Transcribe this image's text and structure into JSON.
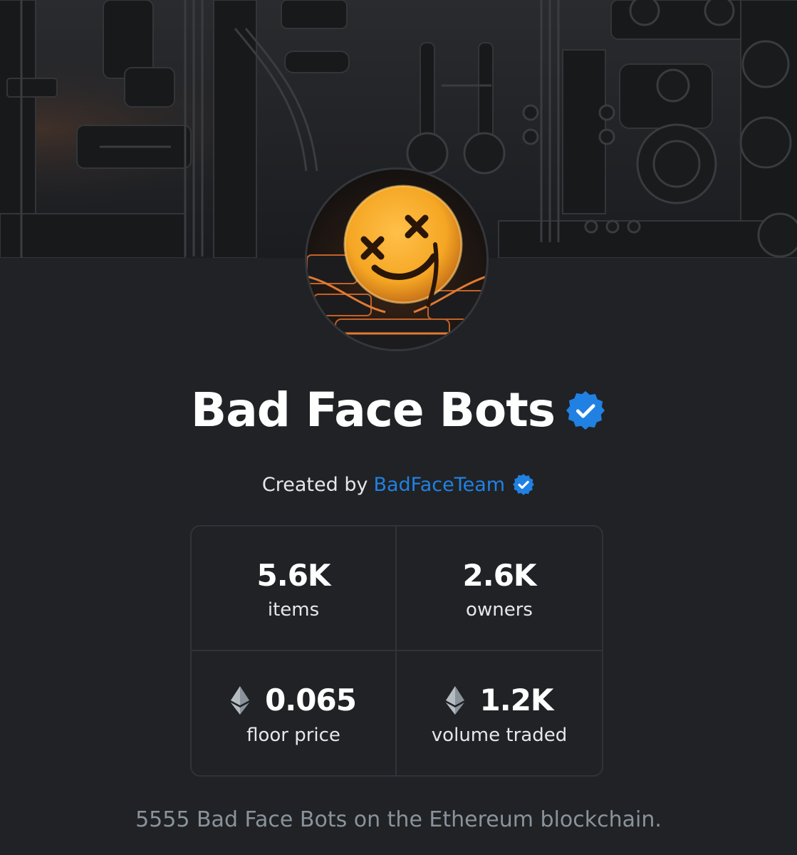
{
  "collection": {
    "name": "Bad Face Bots",
    "verified_icon": "verified-badge-icon",
    "creator_prefix": "Created by",
    "creator_name": "BadFaceTeam",
    "description": "5555 Bad Face Bots on the Ethereum blockchain."
  },
  "stats": [
    {
      "value": "5.6K",
      "label": "items",
      "icon": ""
    },
    {
      "value": "2.6K",
      "label": "owners",
      "icon": ""
    },
    {
      "value": "0.065",
      "label": "floor price",
      "icon": "ethereum-icon"
    },
    {
      "value": "1.2K",
      "label": "volume traded",
      "icon": "ethereum-icon"
    }
  ],
  "colors": {
    "background": "#202225",
    "accent_link": "#2081e2",
    "verified_badge": "#2081e2",
    "muted_text": "#8a939b",
    "card_border": "#303339",
    "avatar_face": "#f5a623"
  }
}
